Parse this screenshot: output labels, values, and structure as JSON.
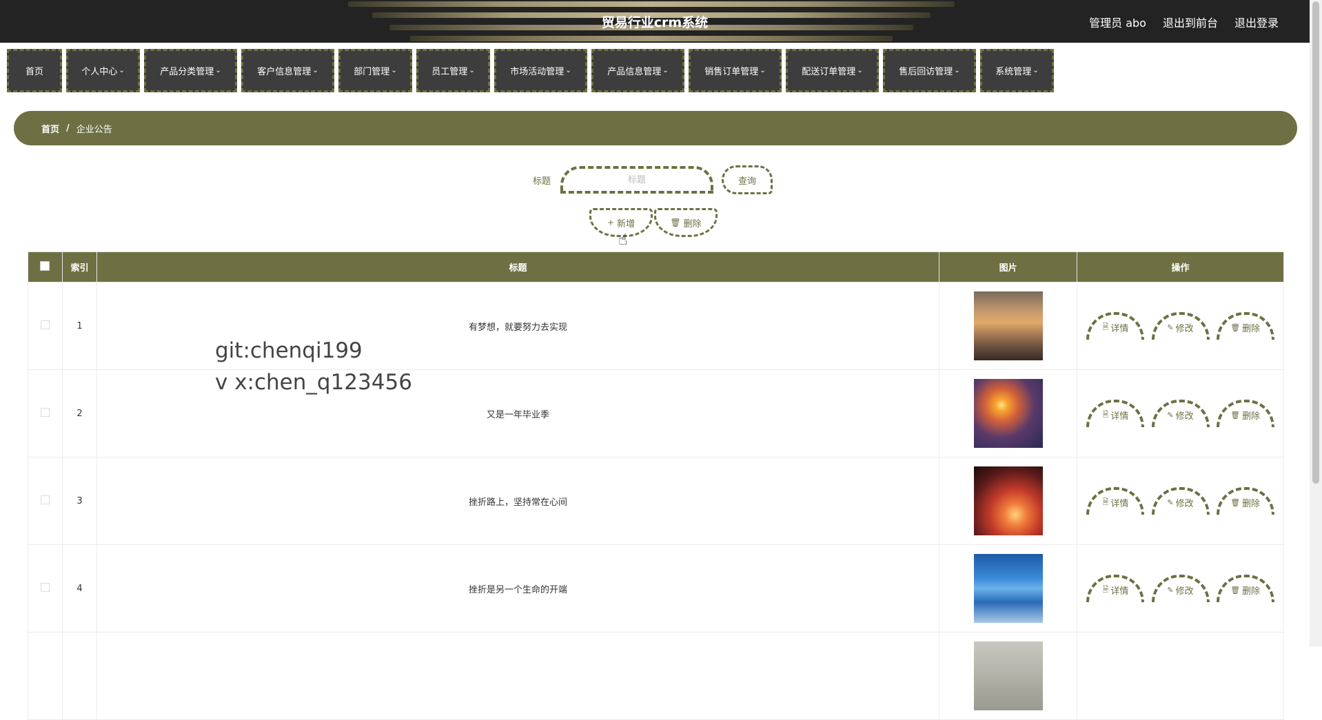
{
  "header": {
    "app_title": "贸易行业crm系统",
    "user_label": "管理员 abo",
    "to_front_label": "退出到前台",
    "logout_label": "退出登录"
  },
  "nav": {
    "items": [
      {
        "label": "首页",
        "has_dropdown": false
      },
      {
        "label": "个人中心",
        "has_dropdown": true
      },
      {
        "label": "产品分类管理",
        "has_dropdown": true
      },
      {
        "label": "客户信息管理",
        "has_dropdown": true
      },
      {
        "label": "部门管理",
        "has_dropdown": true
      },
      {
        "label": "员工管理",
        "has_dropdown": true
      },
      {
        "label": "市场活动管理",
        "has_dropdown": true
      },
      {
        "label": "产品信息管理",
        "has_dropdown": true
      },
      {
        "label": "销售订单管理",
        "has_dropdown": true
      },
      {
        "label": "配送订单管理",
        "has_dropdown": true
      },
      {
        "label": "售后回访管理",
        "has_dropdown": true
      },
      {
        "label": "系统管理",
        "has_dropdown": true
      }
    ]
  },
  "breadcrumb": {
    "home": "首页",
    "separator": "/",
    "current": "企业公告"
  },
  "search": {
    "label": "标题",
    "placeholder": "标题",
    "query_label": "查询"
  },
  "actions": {
    "add_label": "新增",
    "delete_label": "删除"
  },
  "table": {
    "headers": {
      "index": "索引",
      "title": "标题",
      "image": "图片",
      "ops": "操作"
    },
    "op_labels": {
      "detail": "详情",
      "edit": "修改",
      "delete": "删除"
    },
    "rows": [
      {
        "index": "1",
        "title": "有梦想，就要努力去实现",
        "image_theme": "misty-sunrise"
      },
      {
        "index": "2",
        "title": "又是一年毕业季",
        "image_theme": "sunset-river"
      },
      {
        "index": "3",
        "title": "挫折路上，坚持常在心间",
        "image_theme": "red-sky-tree"
      },
      {
        "index": "4",
        "title": "挫折是另一个生命的开端",
        "image_theme": "blue-lake"
      }
    ]
  },
  "watermark": {
    "line1": "git:chenqi199",
    "line2": "v x:chen_q123456"
  },
  "colors": {
    "accent": "#6e7043",
    "topbar": "#232323",
    "nav_bg": "#3d3d3d"
  }
}
